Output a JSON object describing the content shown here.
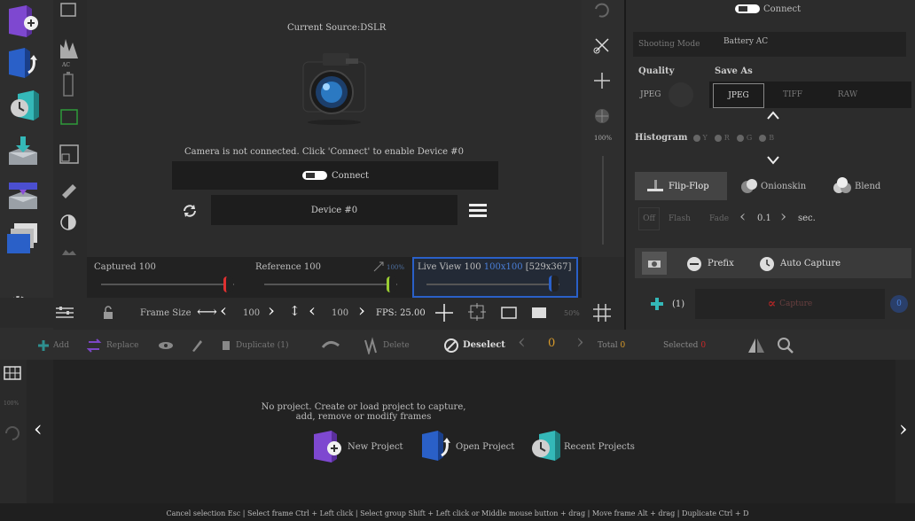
{
  "colors": {
    "accent_blue": "#2a60c8",
    "accent_teal": "#34b8b8",
    "red": "#e03030",
    "green": "#9acd32",
    "purple": "#8a4fd8",
    "panel_dark": "#1c1c1c"
  },
  "preview": {
    "current_source": "Current Source:DSLR",
    "camera_message": "Camera is not connected. Click 'Connect' to enable Device #0",
    "connect_label": "Connect",
    "device_label": "Device #0",
    "zoom_level": "100%"
  },
  "sliders": {
    "captured_label": "Captured 100",
    "reference_label": "Reference 100",
    "reference_pct": "100%",
    "live_view_label": "Live View 100",
    "live_view_res": "100x100",
    "live_view_size": "[529x367]"
  },
  "toolbar": {
    "frame_size_label": "Frame Size",
    "width_value": "100",
    "height_value": "100",
    "fps_label": "FPS: 25.00",
    "opacity_value": "50%"
  },
  "right_panel": {
    "connect_label": "Connect",
    "shooting_mode_label": "Shooting Mode",
    "shooting_mode_value": "Battery AC",
    "quality_label": "Quality",
    "save_as_label": "Save As",
    "quality_value": "JPEG",
    "formats": [
      "JPEG",
      "TIFF",
      "RAW"
    ],
    "histogram_label": "Histogram",
    "histogram_channels": [
      "Y",
      "R",
      "G",
      "B"
    ],
    "tabs": [
      "Flip-Flop",
      "Onionskin",
      "Blend"
    ],
    "flip_options": [
      "Off",
      "Flash",
      "Fade"
    ],
    "flip_value": "0.1",
    "flip_unit": "sec.",
    "prefix_label": "Prefix",
    "auto_capture_label": "Auto Capture",
    "add_count": "(1)",
    "capture_label": "Capture",
    "capture_count": "0"
  },
  "timeline_toolbar": {
    "add": "Add",
    "replace": "Replace",
    "duplicate": "Duplicate (1)",
    "delete": "Delete",
    "deselect": "Deselect",
    "current_frame": "0",
    "total_label": "Total",
    "total_value": "0",
    "selected_label": "Selected",
    "selected_value": "0"
  },
  "timeline": {
    "zoom": "100%",
    "message_line1": "No project. Create or load project to capture,",
    "message_line2": "add, remove or modify frames",
    "new_project": "New Project",
    "open_project": "Open Project",
    "recent_projects": "Recent Projects"
  },
  "status_bar": {
    "hints": "Cancel selection Esc | Select frame Ctrl + Left click | Select group Shift + Left click  or Middle mouse button + drag | Move frame Alt + drag | Duplicate Ctrl + D"
  }
}
